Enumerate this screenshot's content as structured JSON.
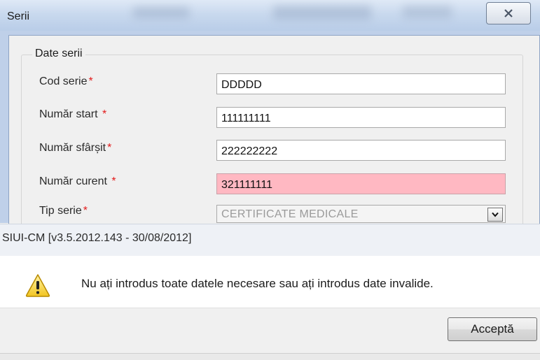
{
  "window": {
    "title": "Serii"
  },
  "form": {
    "group_title": "Date serii",
    "required_mark": "*",
    "fields": [
      {
        "label": "Cod serie",
        "value": "DDDDD"
      },
      {
        "label": "Număr start",
        "value": "111111111"
      },
      {
        "label": "Număr sfârșit",
        "value": "222222222"
      },
      {
        "label": "Număr curent",
        "value": "321111111"
      }
    ],
    "tip_serie": {
      "label": "Tip serie",
      "value": "CERTIFICATE MEDICALE"
    }
  },
  "message_box": {
    "title": "SIUI-CM [v3.5.2012.143 - 30/08/2012]",
    "text": "Nu ați introdus toate datele necesare sau ați introdus date invalide.",
    "button_label": "Acceptă",
    "icon": "warning-icon"
  },
  "colors": {
    "invalid_field": "#ffb8c2",
    "required_mark": "#e31b1b"
  }
}
